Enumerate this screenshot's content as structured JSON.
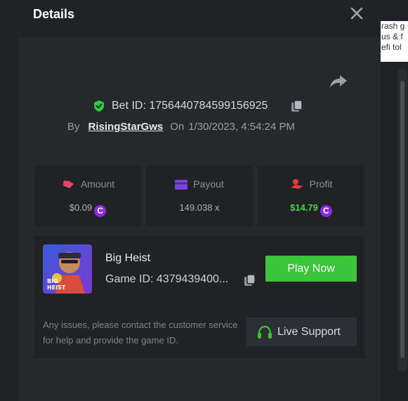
{
  "background": {
    "peek_lines": [
      "rash g",
      "us & f",
      "efi tol"
    ]
  },
  "modal": {
    "title": "Details",
    "bet_id_text": "Bet ID: 1756440784599156925",
    "by_label": "By",
    "username": "RisingStarGws",
    "on_label": "On",
    "datetime": "1/30/2023, 4:54:24 PM"
  },
  "stats": {
    "amount_label": "Amount",
    "amount_value": "$0.09",
    "payout_label": "Payout",
    "payout_value": "149.038 x",
    "profit_label": "Profit",
    "profit_value": "$14.79",
    "coin_glyph": "C"
  },
  "game": {
    "name": "Big Heist",
    "id_text": "Game ID: 4379439400...",
    "thumb_text": "BIG HEIST",
    "play_label": "Play Now",
    "help_text": "Any issues, please contact the customer service for help and provide the game ID.",
    "support_label": "Live Support"
  },
  "colors": {
    "accent_green": "#3cc43a",
    "profit_green": "#4ed14a",
    "coin_purple": "#8a2be2",
    "shield_green": "#2ecc40"
  }
}
